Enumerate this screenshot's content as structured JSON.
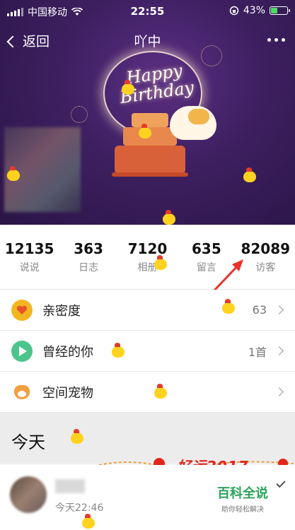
{
  "status_bar": {
    "carrier": "中国移动",
    "time": "22:55",
    "battery_percent": "43%",
    "battery_level": 0.43
  },
  "nav": {
    "back_label": "返回",
    "title": "吖中"
  },
  "banner": {
    "greeting": "Happy Birthday"
  },
  "stats": [
    {
      "value": "12135",
      "label": "说说"
    },
    {
      "value": "363",
      "label": "日志"
    },
    {
      "value": "7120",
      "label": "相册"
    },
    {
      "value": "635",
      "label": "留言"
    },
    {
      "value": "82089",
      "label": "访客"
    }
  ],
  "list": [
    {
      "label": "亲密度",
      "value": "63",
      "icon": "heart-icon"
    },
    {
      "label": "曾经的你",
      "value": "1首",
      "icon": "play-icon"
    },
    {
      "label": "空间宠物",
      "value": "",
      "icon": "pet-dog-icon"
    }
  ],
  "today": {
    "title": "今天",
    "banner_text": "好运2017",
    "post_time": "今天22:46"
  },
  "watermark": {
    "title": "百科全说",
    "subtitle": "助你轻松解决"
  },
  "colors": {
    "accent_green": "#2aa45a",
    "arrow_red": "#e8322a",
    "banner_purple": "#3d1f60"
  }
}
